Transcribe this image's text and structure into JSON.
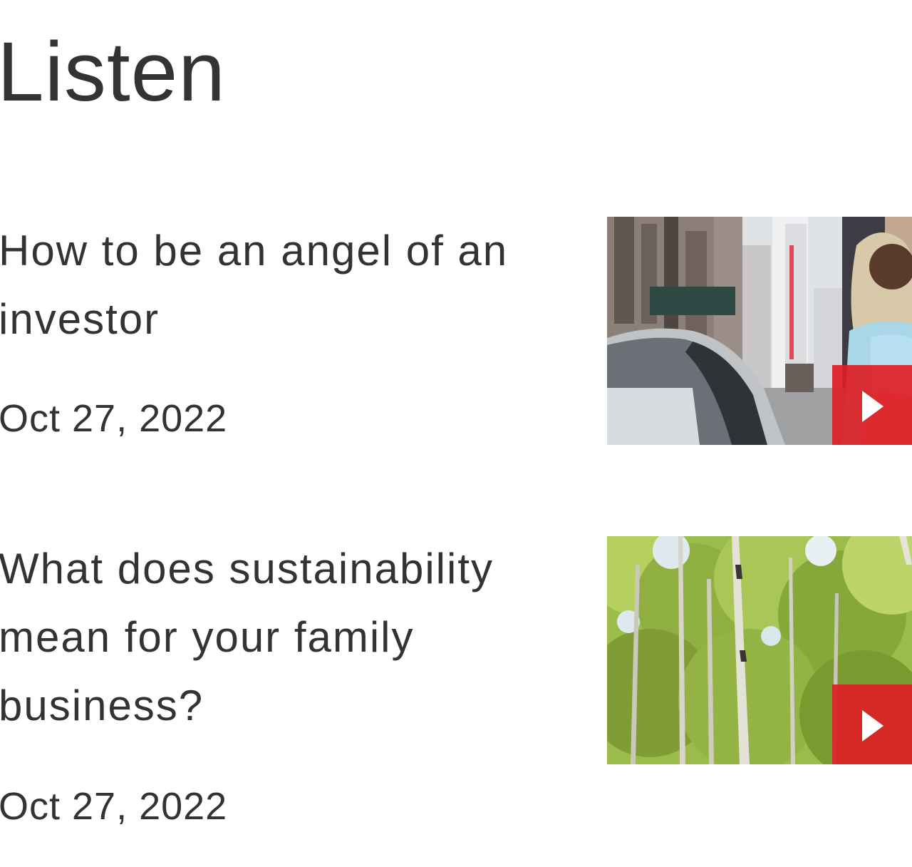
{
  "page": {
    "title": "Listen"
  },
  "items": [
    {
      "title": "How to be an angel of an investor",
      "date": "Oct 27, 2022",
      "image": "city-street-woman-phone-photo",
      "play_icon": "play-icon"
    },
    {
      "title": "What does sustainability mean for your family business?",
      "date": "Oct 27, 2022",
      "image": "birch-forest-photo",
      "play_icon": "play-icon"
    }
  ],
  "colors": {
    "text": "#333333",
    "accent": "#dd1e25",
    "background": "#ffffff"
  }
}
